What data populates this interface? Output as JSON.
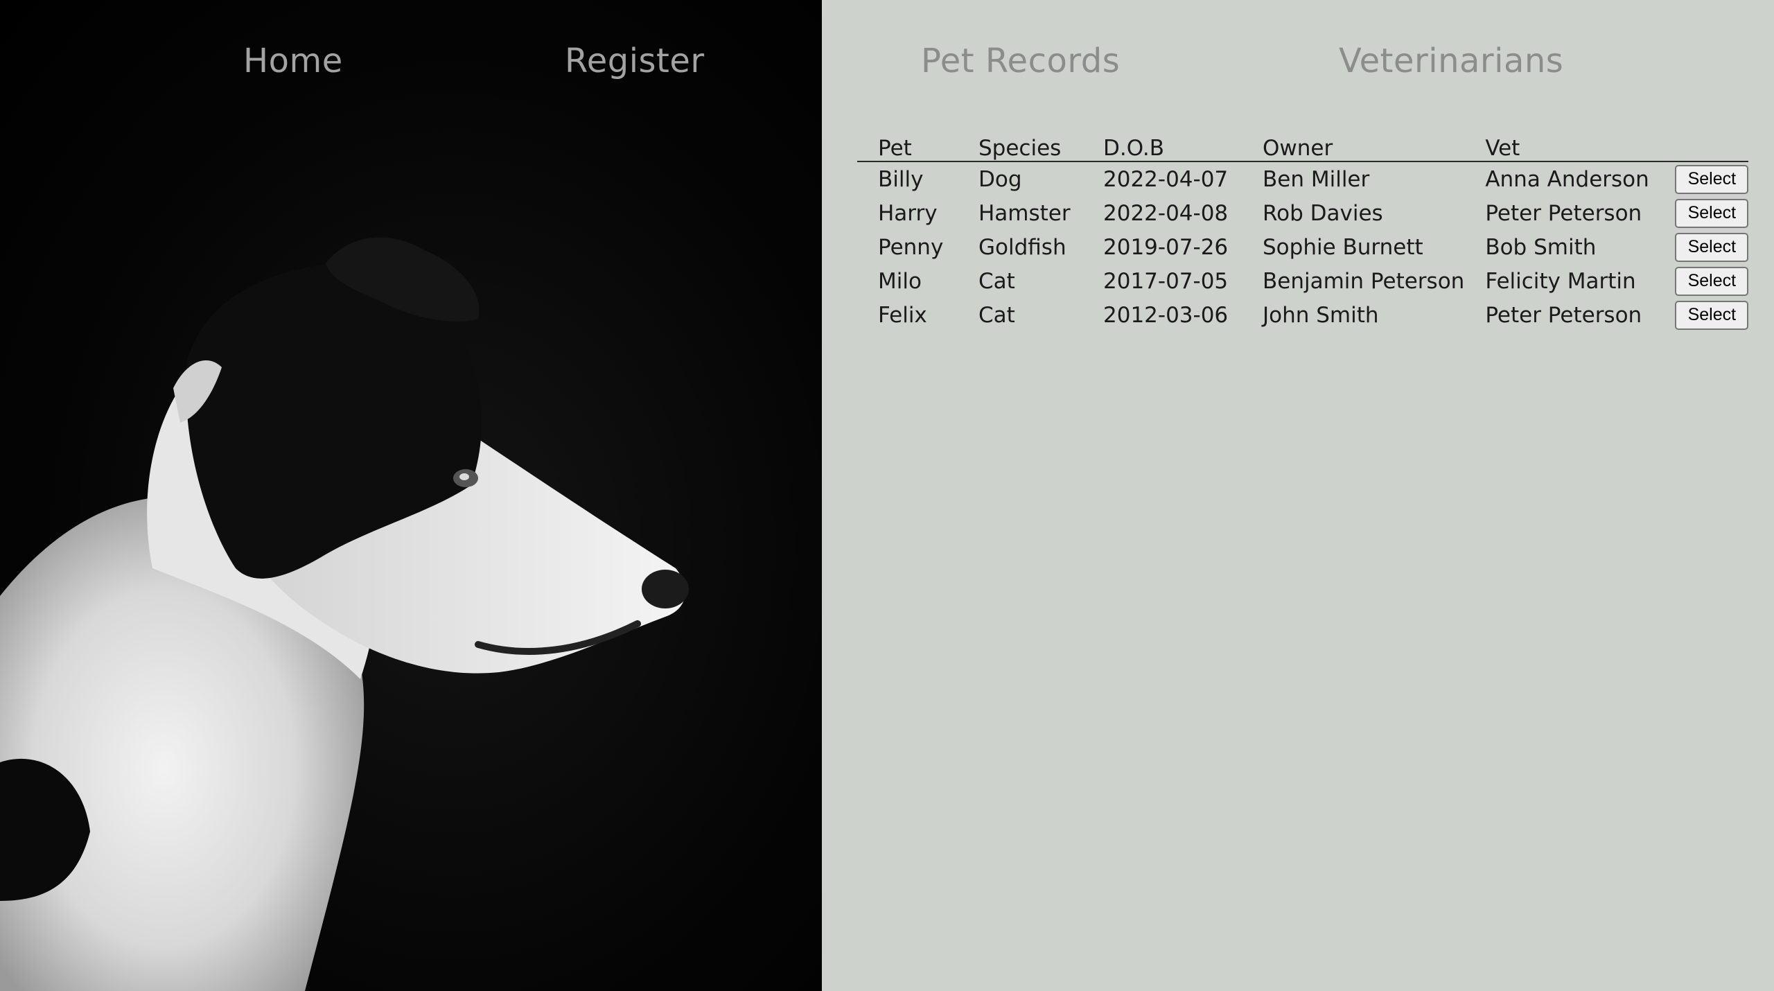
{
  "nav": {
    "home": "Home",
    "register": "Register",
    "pet_records": "Pet Records",
    "veterinarians": "Veterinarians"
  },
  "table": {
    "headers": [
      "Pet",
      "Species",
      "D.O.B",
      "Owner",
      "Vet"
    ],
    "rows": [
      {
        "pet": "Billy",
        "species": "Dog",
        "dob": "2022-04-07",
        "owner": "Ben Miller",
        "vet": "Anna Anderson",
        "action": "Select"
      },
      {
        "pet": "Harry",
        "species": "Hamster",
        "dob": "2022-04-08",
        "owner": "Rob Davies",
        "vet": "Peter Peterson",
        "action": "Select"
      },
      {
        "pet": "Penny",
        "species": "Goldfish",
        "dob": "2019-07-26",
        "owner": "Sophie Burnett",
        "vet": "Bob Smith",
        "action": "Select"
      },
      {
        "pet": "Milo",
        "species": "Cat",
        "dob": "2017-07-05",
        "owner": "Benjamin Peterson",
        "vet": "Felicity Martin",
        "action": "Select"
      },
      {
        "pet": "Felix",
        "species": "Cat",
        "dob": "2012-03-06",
        "owner": "John Smith",
        "vet": "Peter Peterson",
        "action": "Select"
      }
    ]
  },
  "hero_image": {
    "icon": "dog-portrait-photo"
  },
  "colors": {
    "nav_text": "#a3a3a3",
    "content_background": "#cdd2cd",
    "photo_background": "#000000"
  }
}
